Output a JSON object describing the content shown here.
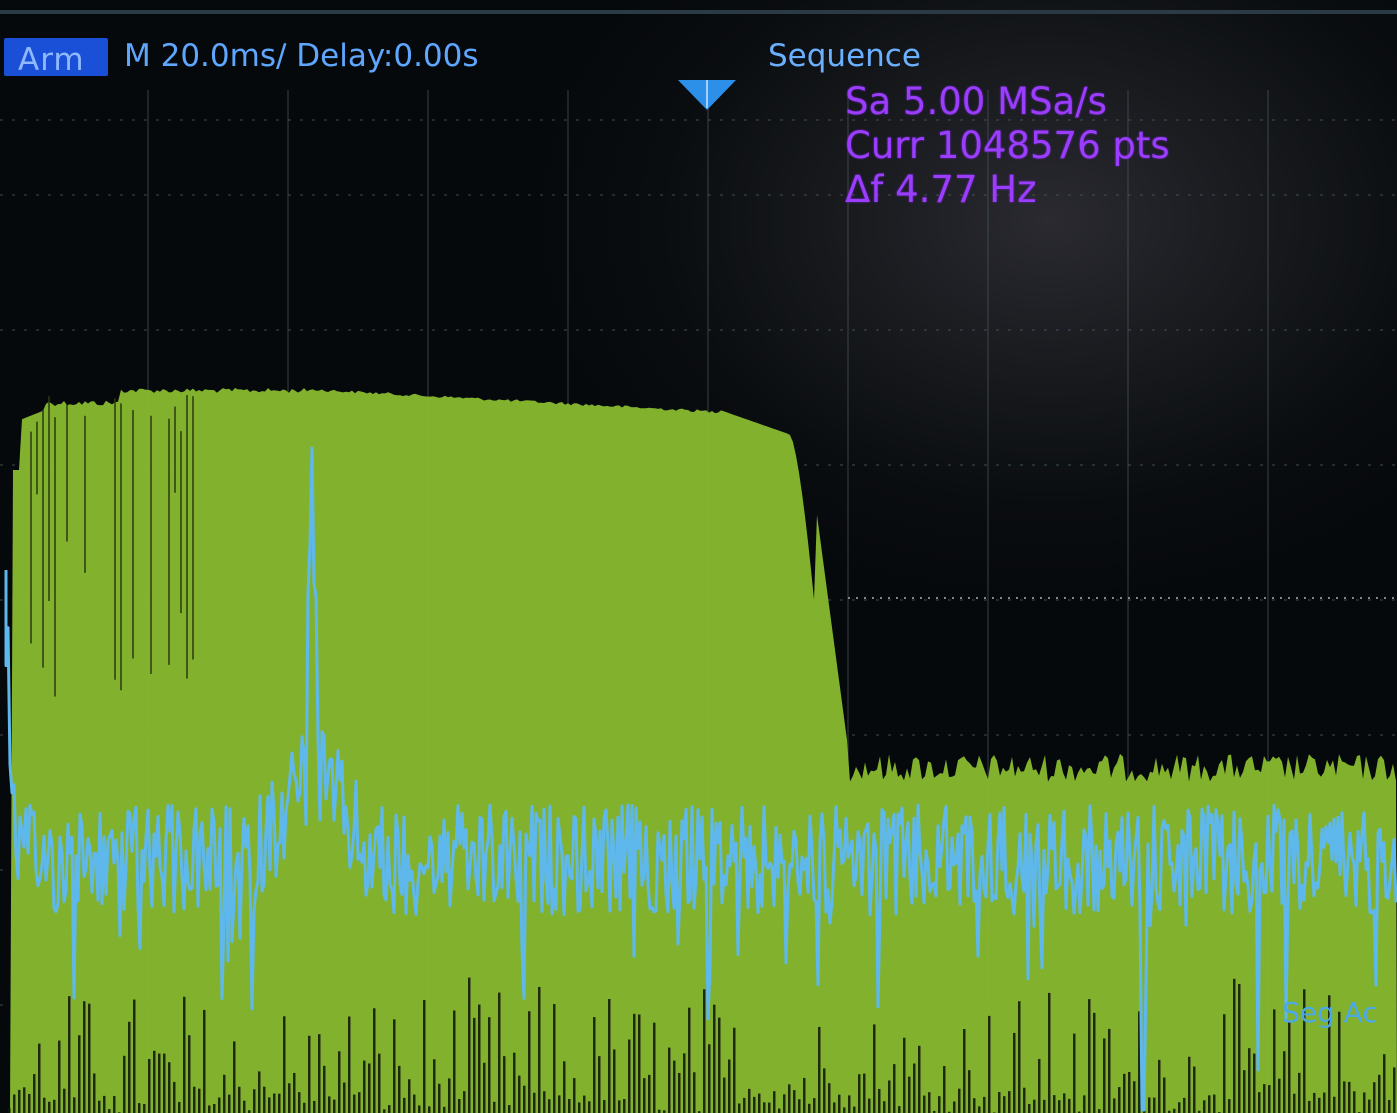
{
  "status_bar": {
    "arm_badge": "Arm",
    "timebase": "M 20.0ms/ Delay:0.00s",
    "acquisition_mode": "Sequence"
  },
  "measurement_info": {
    "sample_rate": "Sa 5.00 MSa/s",
    "current_points": "Curr 1048576 pts",
    "frequency_resolution": "Δf 4.77 Hz"
  },
  "segment_label": "Seg Ac",
  "colors": {
    "fft_trace_fill": "#86b82e",
    "spectrum_trace": "#5fb8ec",
    "info_text": "#9b3cff",
    "arm_badge": "#1a4fd8",
    "grid": "#5d6a70"
  },
  "icons": {
    "trigger_marker": "down-triangle-icon"
  }
}
